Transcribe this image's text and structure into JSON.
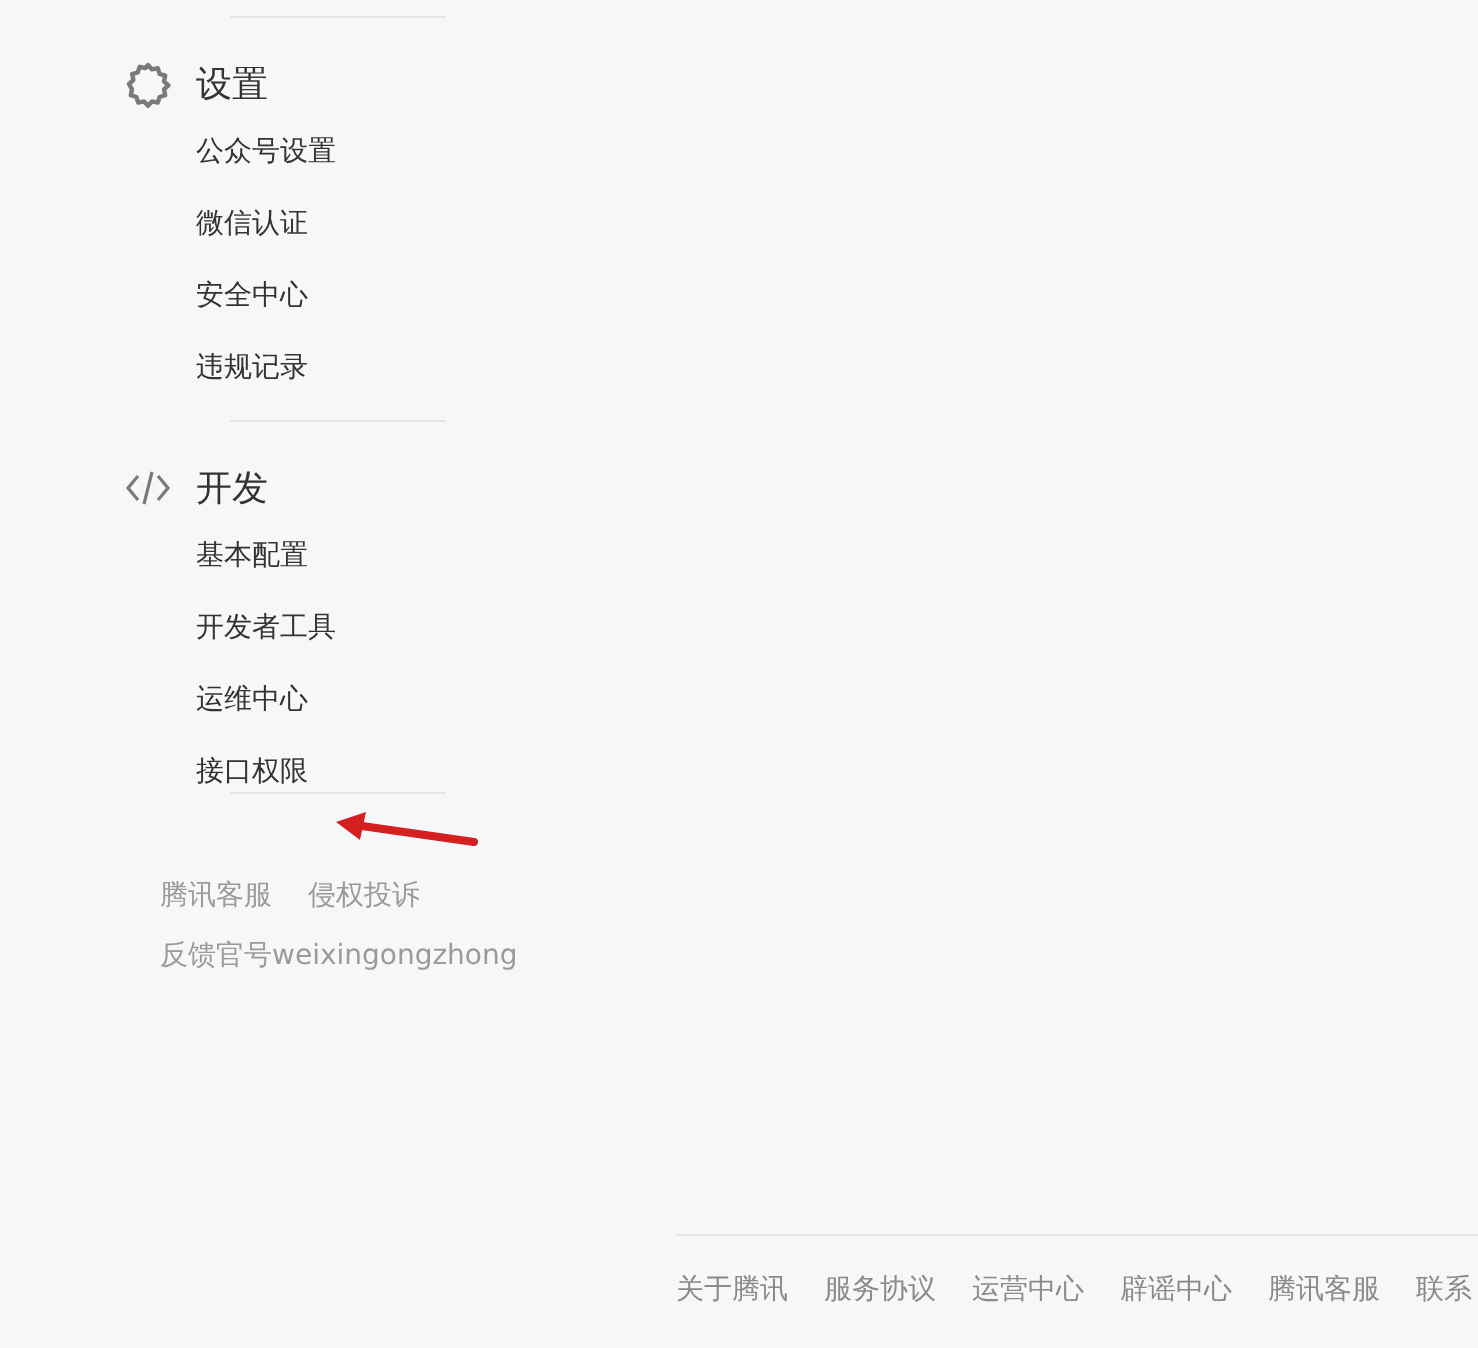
{
  "sidebar": {
    "sections": [
      {
        "kind": "settings",
        "title": "设置",
        "items": [
          {
            "label": "公众号设置"
          },
          {
            "label": "微信认证"
          },
          {
            "label": "安全中心"
          },
          {
            "label": "违规记录"
          }
        ]
      },
      {
        "kind": "code",
        "title": "开发",
        "items": [
          {
            "label": "基本配置"
          },
          {
            "label": "开发者工具"
          },
          {
            "label": "运维中心"
          },
          {
            "label": "接口权限"
          }
        ]
      }
    ],
    "footer_links": [
      [
        "腾讯客服",
        "侵权投诉"
      ],
      [
        "反馈官号weixingongzhong"
      ]
    ]
  },
  "footer": {
    "links": [
      "关于腾讯",
      "服务协议",
      "运营中心",
      "辟谣中心",
      "腾讯客服",
      "联系"
    ]
  }
}
